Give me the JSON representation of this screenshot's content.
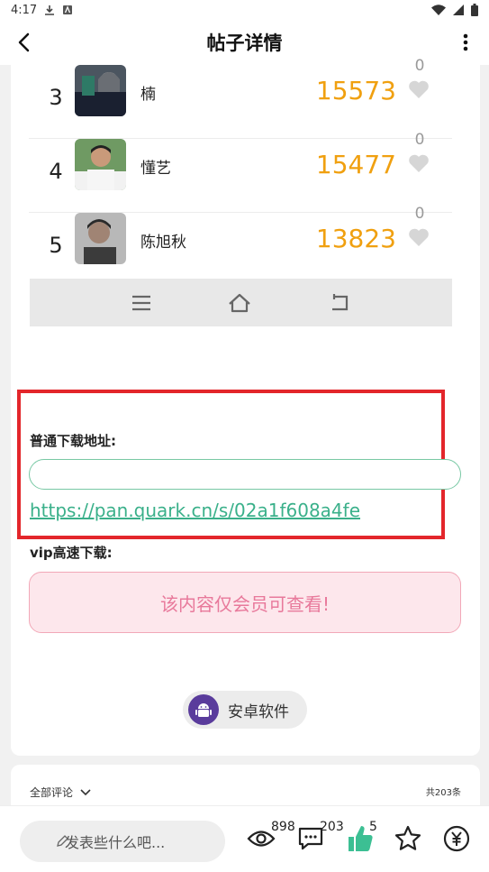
{
  "status_bar": {
    "time": "4:17"
  },
  "header": {
    "title": "帖子详情"
  },
  "ranking": [
    {
      "rank": "3",
      "name": "楠",
      "score": "15573",
      "likes": "0"
    },
    {
      "rank": "4",
      "name": "懂艺",
      "score": "15477",
      "likes": "0"
    },
    {
      "rank": "5",
      "name": "陈旭秋",
      "score": "13823",
      "likes": "0"
    }
  ],
  "download": {
    "normal_label": "普通下载地址:",
    "link": "https://pan.quark.cn/s/02a1f608a4fe",
    "input_value": "",
    "vip_label": "vip高速下载:",
    "vip_notice": "该内容仅会员可查看!"
  },
  "tag": {
    "label": "安卓软件"
  },
  "comments": {
    "filter_label": "全部评论",
    "total": "共203条"
  },
  "bottom_bar": {
    "comment_placeholder": "发表些什么吧...",
    "views": "898",
    "comment_count": "203",
    "like_count": "5"
  },
  "colors": {
    "score": "#f0a010",
    "link": "#3ab08a",
    "highlight": "#e3262b",
    "like_active": "#3cbf93"
  }
}
